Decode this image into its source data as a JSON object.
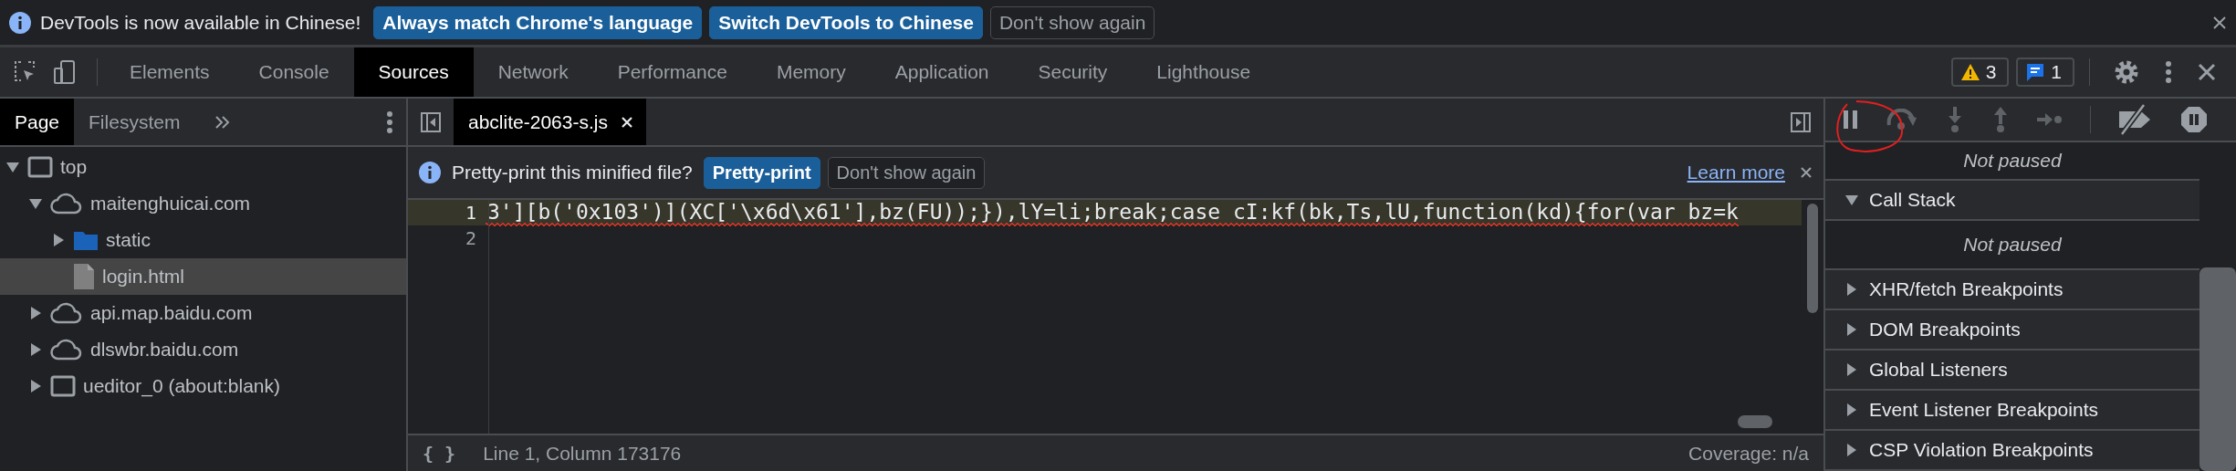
{
  "infobar": {
    "message": "DevTools is now available in Chinese!",
    "buttons": [
      {
        "label": "Always match Chrome's language",
        "kind": "primary"
      },
      {
        "label": "Switch DevTools to Chinese",
        "kind": "primary"
      },
      {
        "label": "Don't show again",
        "kind": "secondary"
      }
    ]
  },
  "tabs": [
    {
      "label": "Elements",
      "selected": false
    },
    {
      "label": "Console",
      "selected": false
    },
    {
      "label": "Sources",
      "selected": true
    },
    {
      "label": "Network",
      "selected": false
    },
    {
      "label": "Performance",
      "selected": false
    },
    {
      "label": "Memory",
      "selected": false
    },
    {
      "label": "Application",
      "selected": false
    },
    {
      "label": "Security",
      "selected": false
    },
    {
      "label": "Lighthouse",
      "selected": false
    }
  ],
  "counters": [
    {
      "kind": "warning",
      "count": "3"
    },
    {
      "kind": "message",
      "count": "1"
    }
  ],
  "navigator": {
    "tabs": [
      {
        "label": "Page",
        "selected": true
      },
      {
        "label": "Filesystem",
        "selected": false
      }
    ],
    "tree": [
      {
        "kind": "frame",
        "label": "top",
        "expanded": true,
        "selected": false,
        "children": [
          {
            "kind": "domain",
            "label": "maitenghuicai.com",
            "expanded": true,
            "selected": false,
            "children": [
              {
                "kind": "folder",
                "label": "static",
                "expanded": false,
                "selected": false
              },
              {
                "kind": "file",
                "label": "login.html",
                "selected": true
              }
            ]
          },
          {
            "kind": "domain",
            "label": "api.map.baidu.com",
            "expanded": false,
            "selected": false
          },
          {
            "kind": "domain",
            "label": "dlswbr.baidu.com",
            "expanded": false,
            "selected": false
          },
          {
            "kind": "frame",
            "label": "ueditor_0 (about:blank)",
            "expanded": false,
            "selected": false
          }
        ]
      }
    ]
  },
  "editor": {
    "file_tab": "abclite-2063-s.js",
    "prettyprint_bar": {
      "message": "Pretty-print this minified file?",
      "buttons": [
        {
          "label": "Pretty-print",
          "kind": "primary"
        },
        {
          "label": "Don't show again",
          "kind": "secondary"
        }
      ],
      "link": "Learn more"
    },
    "lines": [
      {
        "number": "1",
        "code": "3'][b('0x103')](XC['\\x6d\\x61'],bz(FU));}),lY=li;break;case cI:kf(bk,Ts,lU,function(kd){for(var bz=k",
        "highlighted": true,
        "error": true
      },
      {
        "number": "2",
        "highlighted": false
      }
    ],
    "status": {
      "format_button": "{ }",
      "position": "Line 1, Column 173176",
      "coverage": "Coverage: n/a"
    }
  },
  "debugger": {
    "sections": [
      {
        "kind": "message",
        "text": "Not paused"
      },
      {
        "kind": "section",
        "title": "Call Stack",
        "expanded": true
      },
      {
        "kind": "message",
        "text": "Not paused"
      },
      {
        "kind": "section",
        "title": "XHR/fetch Breakpoints",
        "expanded": false
      },
      {
        "kind": "section",
        "title": "DOM Breakpoints",
        "expanded": false
      },
      {
        "kind": "section",
        "title": "Global Listeners",
        "expanded": false
      },
      {
        "kind": "section",
        "title": "Event Listener Breakpoints",
        "expanded": false
      },
      {
        "kind": "section",
        "title": "CSP Violation Breakpoints",
        "expanded": false
      }
    ]
  }
}
